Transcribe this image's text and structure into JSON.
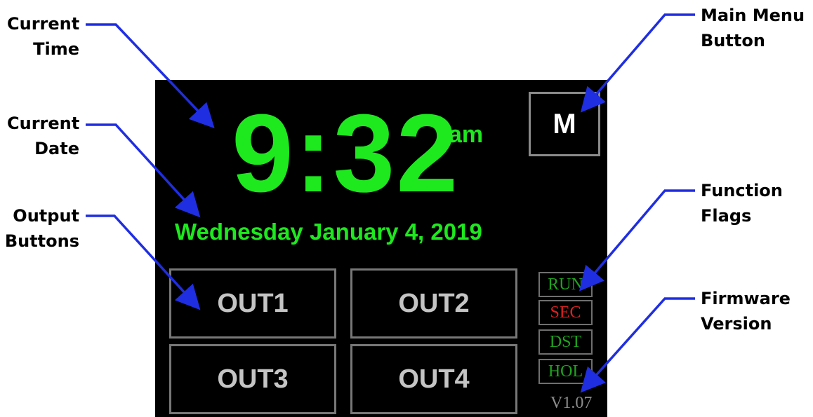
{
  "callouts": {
    "current_time": [
      "Current",
      "Time"
    ],
    "current_date": [
      "Current",
      "Date"
    ],
    "output_buttons": [
      "Output",
      "Buttons"
    ],
    "main_menu": [
      "Main Menu",
      "Button"
    ],
    "function_flags": [
      "Function",
      "Flags"
    ],
    "firmware_version": [
      "Firmware",
      "Version"
    ]
  },
  "display": {
    "time": "9:32",
    "ampm": "am",
    "date": "Wednesday January 4, 2019",
    "menu_label": "M",
    "outputs": [
      "OUT1",
      "OUT2",
      "OUT3",
      "OUT4"
    ],
    "flags": [
      {
        "label": "RUN",
        "color": "#1fa31f"
      },
      {
        "label": "SEC",
        "color": "#e02020"
      },
      {
        "label": "DST",
        "color": "#1fa31f"
      },
      {
        "label": "HOL",
        "color": "#1fa31f"
      }
    ],
    "version": "V1.07"
  },
  "colors": {
    "arrow": "#1f2ee0",
    "lcd_green": "#1ee81e",
    "screen_bg": "#000000"
  }
}
